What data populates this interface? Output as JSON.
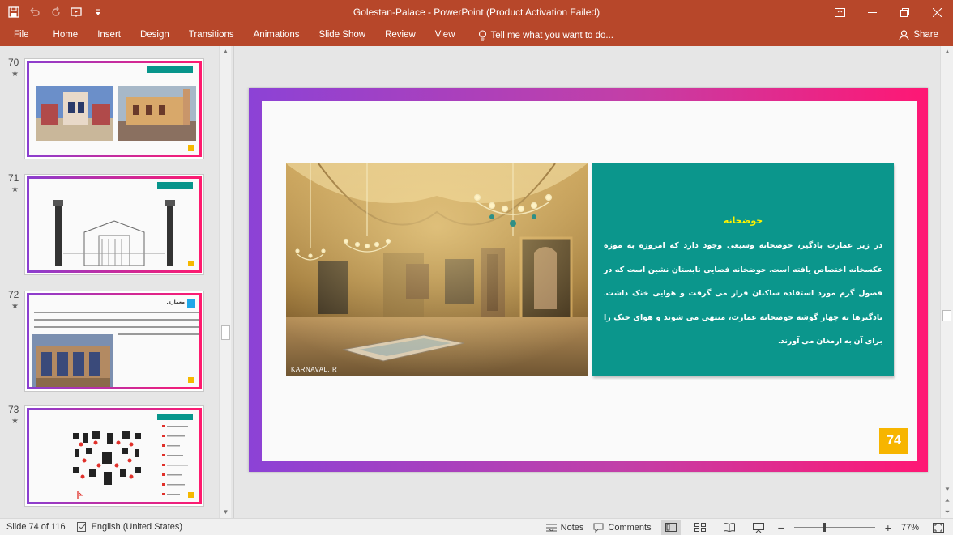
{
  "app": {
    "title": "Golestan-Palace - PowerPoint (Product Activation Failed)",
    "accent_color": "#b7472a"
  },
  "quick_access": [
    {
      "name": "save-icon"
    },
    {
      "name": "undo-icon"
    },
    {
      "name": "redo-icon"
    },
    {
      "name": "start-from-beginning-icon"
    },
    {
      "name": "customize-qat-icon"
    }
  ],
  "ribbon": {
    "tabs": [
      "File",
      "Home",
      "Insert",
      "Design",
      "Transitions",
      "Animations",
      "Slide Show",
      "Review",
      "View"
    ],
    "tell_me": "Tell me what you want to do...",
    "share": "Share"
  },
  "thumbnails": [
    {
      "number": "70",
      "star": "★"
    },
    {
      "number": "71",
      "star": "★"
    },
    {
      "number": "72",
      "star": "★",
      "heading": "معماری"
    },
    {
      "number": "73",
      "star": "★"
    }
  ],
  "slide": {
    "photo_credit": "KARNAVAL.IR",
    "heading": "حوضخانه",
    "body": "در زیر عمارت بادگیر، حوضخانه وسیعی وجود دارد که امروزه به موزه عکسخانه اختصاص یافته است. حوضخانه فضایی تابستان نشین است که در فصول گرم مورد استفاده ساکنان قرار می گرفت و هوایی خنک داشت. بادگیرها به چهار گوشه حوضخانه عمارت، منتهی می شوند و هوای خنک را برای آن به ارمغان می آورند.",
    "number": "74",
    "frame_colors": [
      "#8c42d6",
      "#ff1774"
    ],
    "box_color": "#0b968c",
    "heading_color": "#fff200",
    "badge_color": "#f7b500"
  },
  "status": {
    "slide_info": "Slide 74 of 116",
    "language": "English (United States)",
    "notes": "Notes",
    "comments": "Comments",
    "zoom": "77%",
    "zoom_level": 0.77
  }
}
